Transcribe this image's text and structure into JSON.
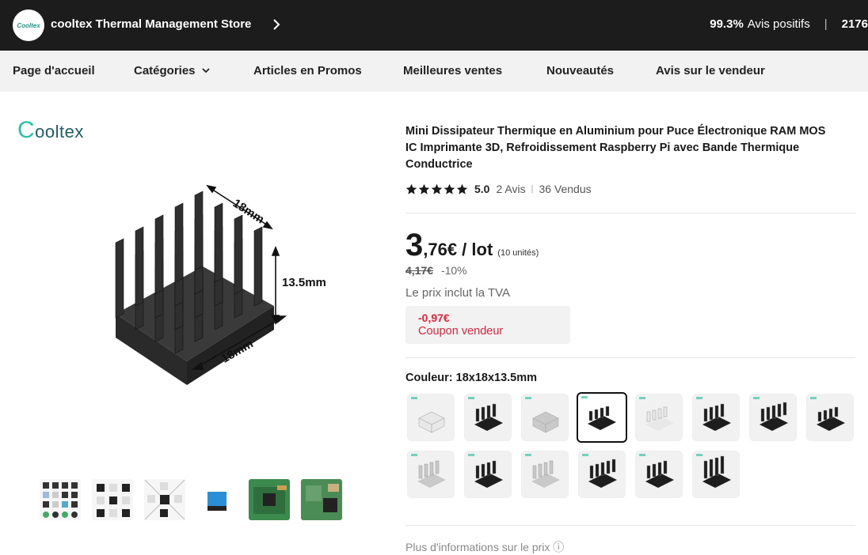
{
  "store": {
    "logo_text": "Cooltex",
    "name": "cooltex Thermal Management Store",
    "rating_percent": "99.3%",
    "rating_label": "Avis positifs",
    "separator": "|",
    "followers_partial": "2176"
  },
  "nav": {
    "items": [
      "Page d'accueil",
      "Catégories",
      "Articles en Promos",
      "Meilleures ventes",
      "Nouveautés",
      "Avis sur le vendeur"
    ]
  },
  "gallery": {
    "brand_logo_first": "C",
    "brand_logo_rest": "ooltex",
    "dim_top": "18mm",
    "dim_right": "13.5mm",
    "dim_bottom": "18mm",
    "thumb_count": 6
  },
  "product": {
    "title": "Mini Dissipateur Thermique en Aluminium pour Puce Électronique RAM MOS IC Imprimante 3D, Refroidissement Raspberry Pi avec Bande Thermique Conductrice",
    "rating": "5.0",
    "stars": 5,
    "reviews": "2 Avis",
    "sold": "36 Vendus",
    "price_int": "3",
    "price_dec": ",76€ / lot",
    "price_unit": "(10 unités)",
    "old_price": "4,17€",
    "discount": "-10%",
    "tva_note": "Le prix inclut la TVA",
    "coupon_amount": "-0,97€",
    "coupon_label": "Coupon vendeur",
    "color_label": "Couleur: 18x18x13.5mm",
    "selected_swatch_index": 3,
    "more_info": "Plus d'informations sur le prix ⓘ"
  },
  "swatches": [
    {
      "tone": "white",
      "fins": "cube"
    },
    {
      "tone": "black",
      "fins": "fins"
    },
    {
      "tone": "silver",
      "fins": "cube"
    },
    {
      "tone": "black",
      "fins": "small"
    },
    {
      "tone": "white",
      "fins": "small"
    },
    {
      "tone": "black",
      "fins": "flat"
    },
    {
      "tone": "black",
      "fins": "pins"
    },
    {
      "tone": "black",
      "fins": "small"
    },
    {
      "tone": "silver",
      "fins": "fins"
    },
    {
      "tone": "black",
      "fins": "fins"
    },
    {
      "tone": "silver",
      "fins": "flat"
    },
    {
      "tone": "black",
      "fins": "pins"
    },
    {
      "tone": "black",
      "fins": "fins"
    },
    {
      "tone": "black",
      "fins": "tall"
    }
  ],
  "colors": {
    "header_bg": "#1c1c1c",
    "nav_bg": "#f2f2f2",
    "coupon_red": "#e2233a",
    "brand_teal": "#27c3a6"
  }
}
